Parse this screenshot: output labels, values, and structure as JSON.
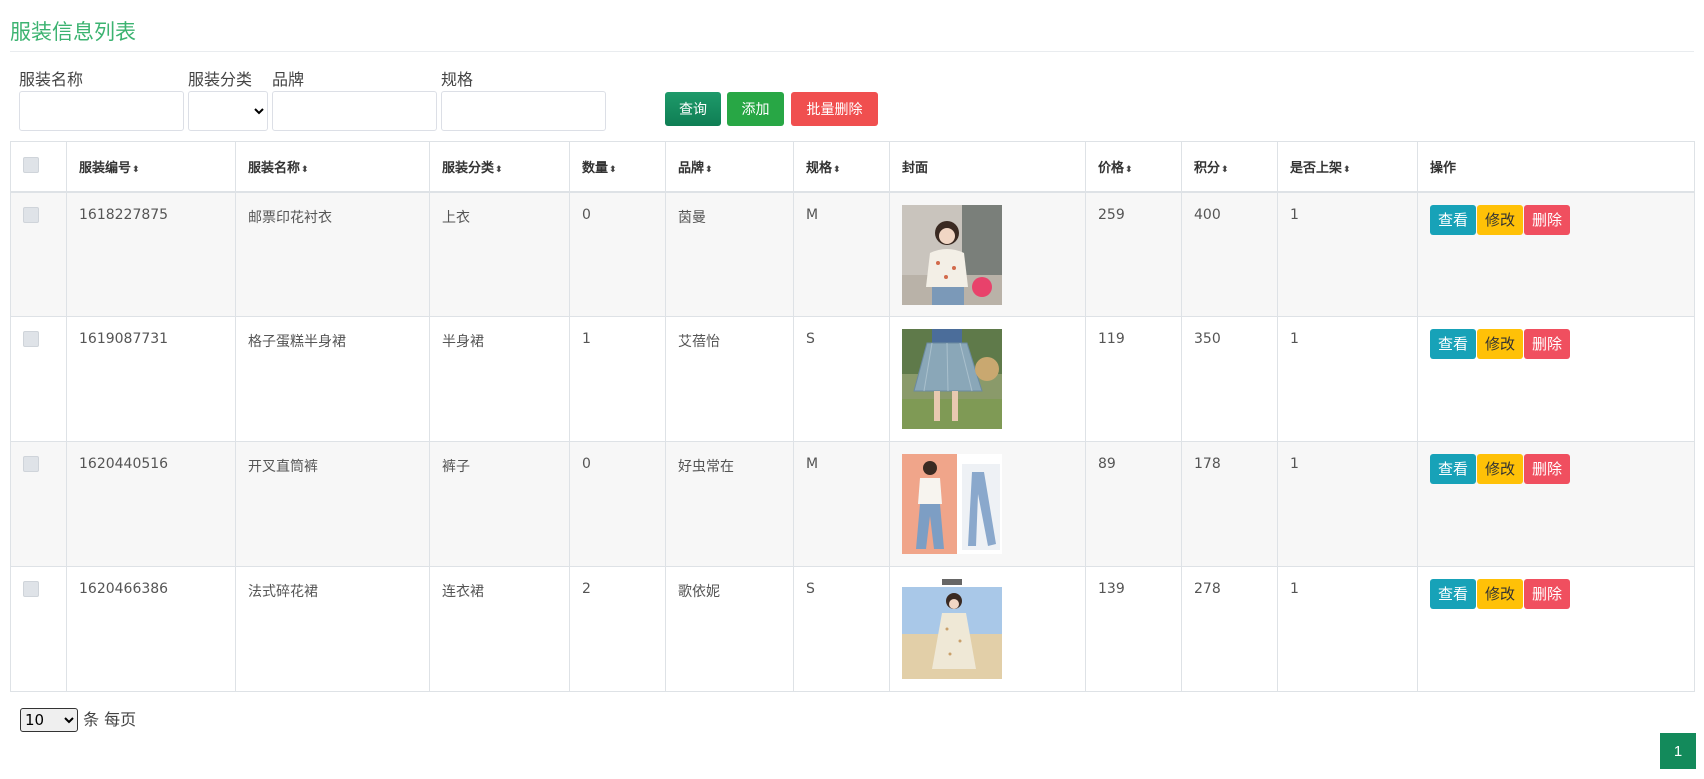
{
  "page": {
    "title": "服装信息列表"
  },
  "filters": {
    "name_label": "服装名称",
    "category_label": "服装分类",
    "brand_label": "品牌",
    "spec_label": "规格",
    "name_value": "",
    "category_value": "",
    "brand_value": "",
    "spec_value": ""
  },
  "buttons": {
    "query": "查询",
    "add": "添加",
    "bulk_delete": "批量删除"
  },
  "table": {
    "headers": [
      "服装编号",
      "服装名称",
      "服装分类",
      "数量",
      "品牌",
      "规格",
      "封面",
      "价格",
      "积分",
      "是否上架",
      "操作"
    ],
    "sort_icon": "⬍",
    "rows": [
      {
        "id": "1618227875",
        "name": "邮票印花衬衣",
        "category": "上衣",
        "qty": "0",
        "brand": "茵曼",
        "spec": "M",
        "price": "259",
        "points": "400",
        "listed": "1"
      },
      {
        "id": "1619087731",
        "name": "格子蛋糕半身裙",
        "category": "半身裙",
        "qty": "1",
        "brand": "艾蓓怡",
        "spec": "S",
        "price": "119",
        "points": "350",
        "listed": "1"
      },
      {
        "id": "1620440516",
        "name": "开叉直筒裤",
        "category": "裤子",
        "qty": "0",
        "brand": "好虫常在",
        "spec": "M",
        "price": "89",
        "points": "178",
        "listed": "1"
      },
      {
        "id": "1620466386",
        "name": "法式碎花裙",
        "category": "连衣裙",
        "qty": "2",
        "brand": "歌依妮",
        "spec": "S",
        "price": "139",
        "points": "278",
        "listed": "1"
      }
    ],
    "actions": {
      "view": "查看",
      "edit": "修改",
      "delete": "删除"
    }
  },
  "pagination": {
    "page_size": "10",
    "page_size_suffix": "条 每页",
    "current_page": "1"
  },
  "colors": {
    "title": "#3cb371",
    "view": "#17a2b8",
    "edit": "#ffc107",
    "delete": "#f04f5f",
    "pager": "#138a5b"
  }
}
